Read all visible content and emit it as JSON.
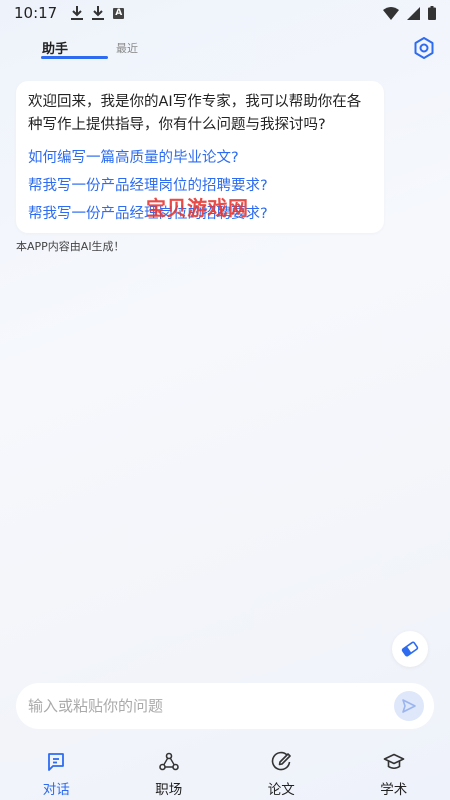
{
  "status_bar": {
    "time": "10:17",
    "icons": [
      "download-icon",
      "download-icon",
      "a-badge-icon",
      "wifi-icon",
      "signal-icon",
      "battery-icon"
    ],
    "a_badge_text": "A"
  },
  "tabs": {
    "assistant": "助手",
    "recent": "最近",
    "active": "assistant"
  },
  "chat": {
    "welcome": "欢迎回来，我是你的AI写作专家，我可以帮助你在各种写作上提供指导，你有什么问题与我探讨吗?",
    "suggestions": [
      "如何编写一篇高质量的毕业论文?",
      "帮我写一份产品经理岗位的招聘要求?",
      "帮我写一份产品经理岗位的招聘要求?"
    ]
  },
  "watermark": "宝贝游戏网",
  "ai_notice": "本APP内容由AI生成！",
  "input": {
    "placeholder": "输入或粘贴你的问题",
    "value": ""
  },
  "bottom_nav": {
    "items": [
      {
        "label": "对话",
        "icon": "chat-icon",
        "active": true
      },
      {
        "label": "职场",
        "icon": "network-icon",
        "active": false
      },
      {
        "label": "论文",
        "icon": "pen-icon",
        "active": false
      },
      {
        "label": "学术",
        "icon": "graduation-cap-icon",
        "active": false
      }
    ]
  },
  "colors": {
    "accent": "#2d6cf0",
    "watermark": "#e53935",
    "background": "#f3f5fa"
  }
}
